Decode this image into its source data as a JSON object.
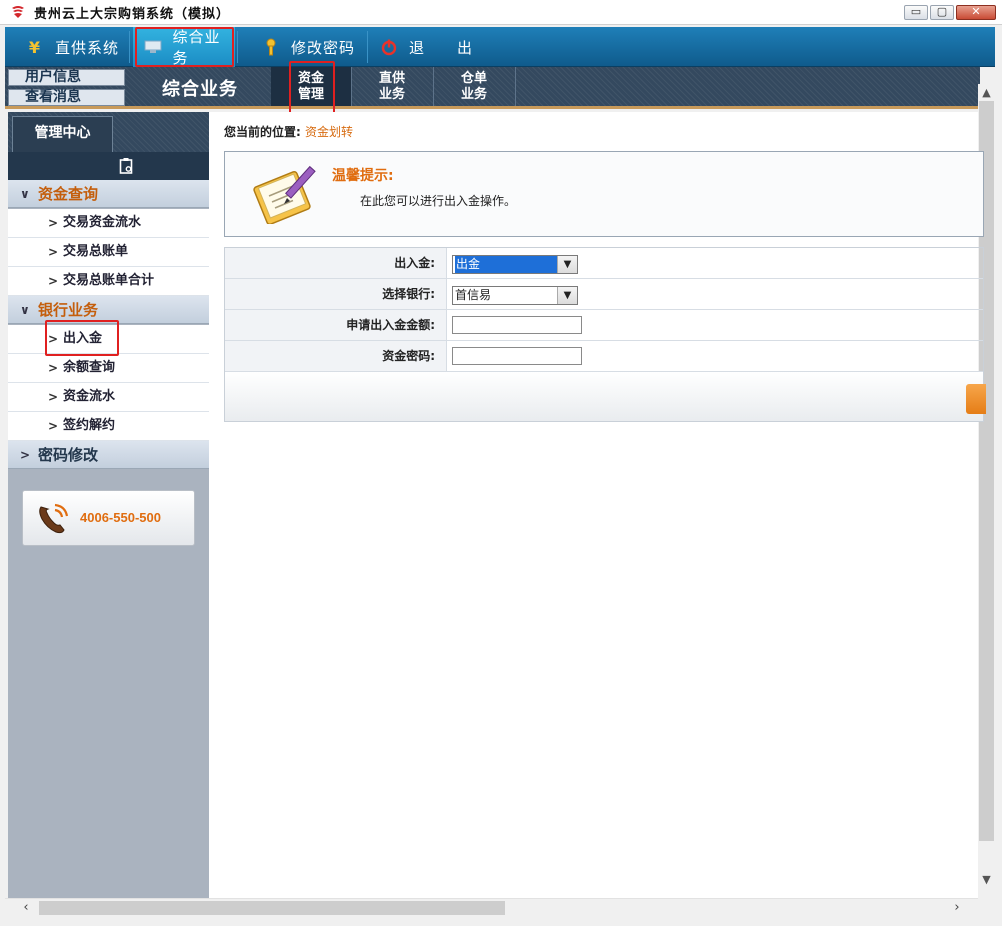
{
  "window": {
    "title": "贵州云上大宗购销系统（模拟）",
    "minimize": "▭",
    "maximize": "▢",
    "close": "✕"
  },
  "topnav": {
    "items": [
      {
        "label": "直供系统",
        "icon": "yen-icon"
      },
      {
        "label": "综合业务",
        "icon": "monitor-icon"
      },
      {
        "label": "修改密码",
        "icon": "key-icon"
      },
      {
        "label": "退　　出",
        "icon": "power-icon"
      }
    ]
  },
  "subbar": {
    "user_info": "用户信息",
    "view_messages": "查看消息",
    "section_title": "综合业务",
    "tabs": [
      {
        "line1": "资金",
        "line2": "管理"
      },
      {
        "line1": "直供",
        "line2": "业务"
      },
      {
        "line1": "仓单",
        "line2": "业务"
      }
    ]
  },
  "sidebar": {
    "tab": "管理中心",
    "groups": [
      {
        "label": "资金查询",
        "items": [
          "交易资金流水",
          "交易总账单",
          "交易总账单合计"
        ]
      },
      {
        "label": "银行业务",
        "items": [
          "出入金",
          "余额查询",
          "资金流水",
          "签约解约"
        ]
      },
      {
        "label": "密码修改",
        "items": []
      }
    ],
    "phone": "4006-550-500"
  },
  "main": {
    "crumb_label": "您当前的位置:",
    "crumb_value": "资金划转",
    "tip_title": "温馨提示:",
    "tip_text": "在此您可以进行出入金操作。",
    "form": {
      "direction_label": "出入金:",
      "direction_value": "出金",
      "bank_label": "选择银行:",
      "bank_value": "首信易",
      "amount_label": "申请出入金金额:",
      "amount_value": "",
      "password_label": "资金密码:",
      "password_value": ""
    }
  },
  "colors": {
    "nav_blue": "#1f7fb8",
    "accent_orange": "#e06d10",
    "highlight_red": "#e02020"
  }
}
